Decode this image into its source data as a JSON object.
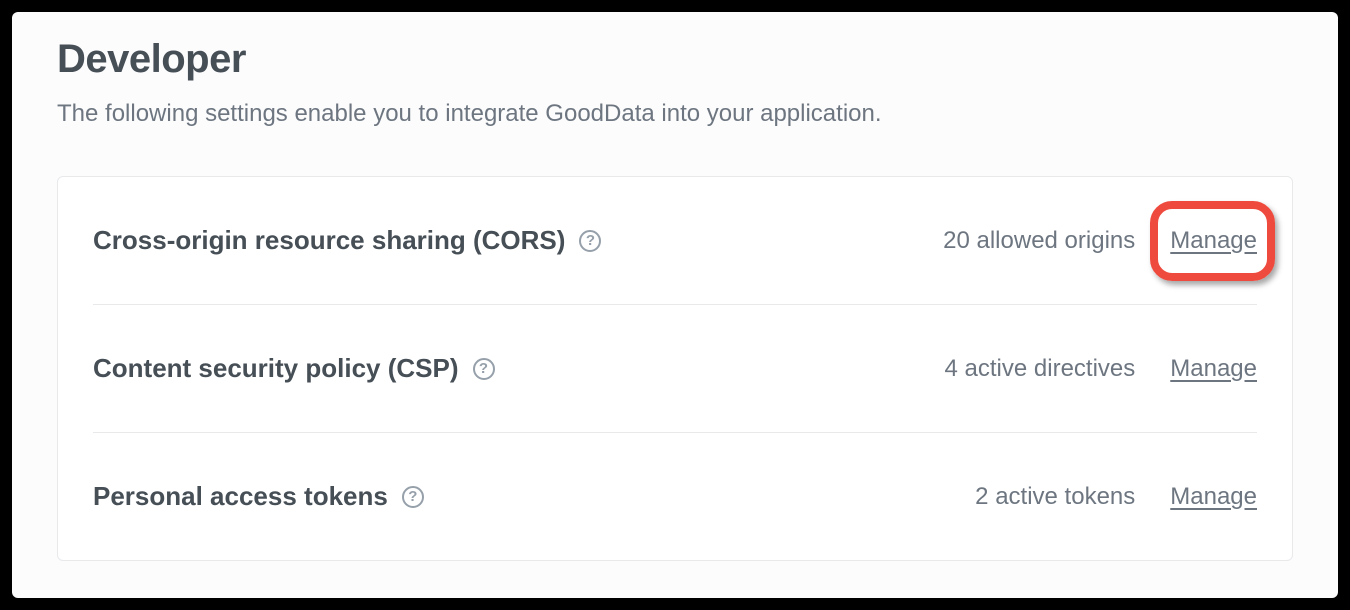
{
  "header": {
    "title": "Developer",
    "description": "The following settings enable you to integrate GoodData into your application."
  },
  "rows": {
    "cors": {
      "title": "Cross-origin resource sharing (CORS)",
      "status": "20 allowed origins",
      "action": "Manage"
    },
    "csp": {
      "title": "Content security policy (CSP)",
      "status": "4 active directives",
      "action": "Manage"
    },
    "pat": {
      "title": "Personal access tokens",
      "status": "2 active tokens",
      "action": "Manage"
    }
  },
  "help_glyph": "?"
}
